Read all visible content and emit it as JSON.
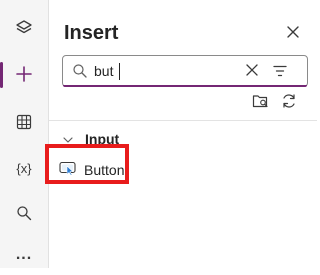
{
  "rail": {
    "items": [
      {
        "icon": "layers-icon"
      },
      {
        "icon": "plus-icon",
        "active": true
      },
      {
        "icon": "data-table-icon"
      },
      {
        "icon": "variables-icon",
        "text": "{x}"
      },
      {
        "icon": "search-icon"
      },
      {
        "icon": "more-icon",
        "text": "..."
      }
    ]
  },
  "panel": {
    "title": "Insert",
    "search": {
      "value": "but",
      "placeholder": ""
    },
    "group": {
      "label": "Input"
    },
    "items": [
      {
        "label": "Button",
        "icon": "button-icon"
      }
    ]
  },
  "colors": {
    "accent": "#742774",
    "highlight": "#e81c1c",
    "rail_bg": "#f5f5f5"
  }
}
